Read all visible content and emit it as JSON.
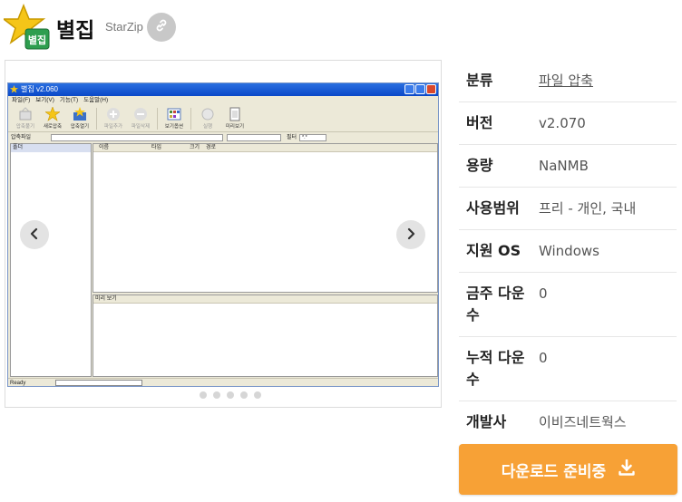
{
  "app": {
    "title": "별집",
    "subtitle": "StarZip",
    "logo_badge": "별집"
  },
  "screenshot": {
    "window_title": "별집 v2.060",
    "menu": [
      "파일(F)",
      "보기(V)",
      "기능(T)",
      "도움말(H)"
    ],
    "toolbar": [
      "압축풀기",
      "새로압축",
      "압축열기",
      "파일추가",
      "파일삭제",
      "보기옵션",
      "실행",
      "미리보기"
    ],
    "address_label": "압축파일",
    "filter_label": "필터",
    "filter_value": "*.*",
    "left_pane_header": "폴더",
    "columns": [
      "이름",
      "타입",
      "크기",
      "경로"
    ],
    "preview_header": "미리 보기",
    "status_text": "Ready"
  },
  "carousel": {
    "slide_count": 5,
    "active_index": 0
  },
  "info": {
    "rows": [
      {
        "label": "분류",
        "value": "파일 압축"
      },
      {
        "label": "버전",
        "value": "v2.070"
      },
      {
        "label": "용량",
        "value": "NaNMB"
      },
      {
        "label": "사용범위",
        "value": "프리 - 개인, 국내"
      },
      {
        "label": "지원 OS",
        "value": "Windows"
      },
      {
        "label": "금주 다운수",
        "value": "0"
      },
      {
        "label": "누적 다운수",
        "value": "0"
      },
      {
        "label": "개발사",
        "value": "이비즈네트웍스"
      }
    ]
  },
  "download": {
    "label": "다운로드 준비중"
  },
  "colors": {
    "download_orange": "#f7a136",
    "star_yellow": "#f5c518",
    "badge_green": "#2e9e4f",
    "link_gray": "#c8c8c8"
  },
  "icons": [
    "star-logo-icon",
    "link-icon",
    "chevron-left-icon",
    "chevron-right-icon",
    "download-icon"
  ]
}
